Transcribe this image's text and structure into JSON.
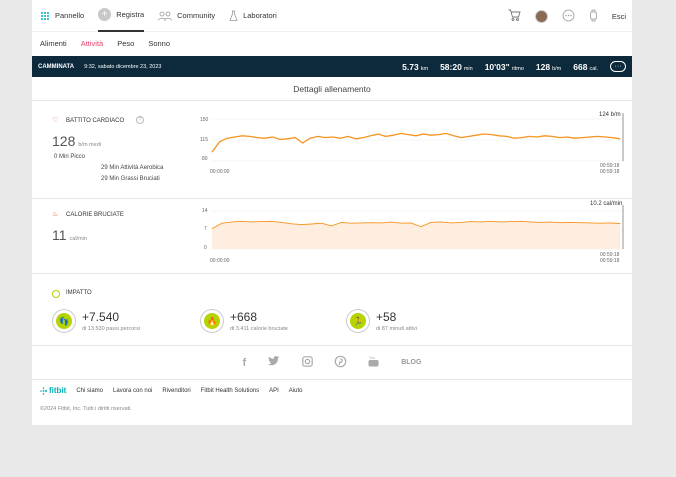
{
  "nav": {
    "items": [
      {
        "label": "Pannello",
        "icon": "dashboard-icon"
      },
      {
        "label": "Registra",
        "icon": "plus-icon"
      },
      {
        "label": "Community",
        "icon": "community-icon"
      },
      {
        "label": "Laboratori",
        "icon": "labs-icon"
      }
    ],
    "logout": "Esci"
  },
  "subnav": [
    "Alimenti",
    "Attività",
    "Peso",
    "Sonno"
  ],
  "activity": {
    "label": "CAMMINATA",
    "date": "9:32, sabato dicembre 23, 2023",
    "stats": [
      {
        "value": "5.73",
        "unit": "km"
      },
      {
        "value": "58:20",
        "unit": "min"
      },
      {
        "value": "10'03\"",
        "unit": "ritmo"
      },
      {
        "value": "128",
        "unit": "b/m"
      },
      {
        "value": "668",
        "unit": "cal."
      }
    ]
  },
  "details_title": "Dettagli allenamento",
  "heart": {
    "title": "BATTITO CARDIACO",
    "value": "128",
    "unit": "b/m medi",
    "peak": "0 Min Picco",
    "aerobic": "29 Min Attività Aerobica",
    "fatburn": "29 Min Grassi Bruciati",
    "max_label": "124 b/m",
    "time_start": "00:00:00",
    "time_end": "00:59:18",
    "time_end2": "00:59:18"
  },
  "calories": {
    "title": "CALORIE BRUCIATE",
    "value": "11",
    "unit": "cal/min",
    "max_label": "10.2 cal/min",
    "time_start": "00:00:00",
    "time_end": "00:59:18",
    "time_end2": "00:59:18"
  },
  "chart_data": [
    {
      "type": "line",
      "title": "BATTITO CARDIACO",
      "yticks": [
        "150",
        "115",
        "80"
      ],
      "ylim": [
        80,
        150
      ],
      "x": [
        "00:00:00",
        "00:59:18"
      ],
      "series": [
        {
          "name": "",
          "values": [
            95,
            112,
            118,
            120,
            122,
            121,
            119,
            118,
            120,
            116,
            117,
            119,
            110,
            118,
            121,
            119,
            120,
            118,
            121,
            117,
            119,
            122,
            125,
            121,
            123,
            126,
            124,
            122,
            125,
            123,
            124,
            126,
            122,
            119,
            121,
            123,
            125,
            124,
            122,
            121,
            118,
            119,
            121,
            120,
            122,
            121,
            119,
            120,
            118,
            119,
            120,
            121,
            120,
            119,
            117
          ]
        }
      ]
    },
    {
      "type": "area",
      "title": "CALORIE BRUCIATE",
      "yticks": [
        "14",
        "7",
        "0"
      ],
      "ylim": [
        0,
        14
      ],
      "x": [
        "00:00:00",
        "00:59:18"
      ],
      "series": [
        {
          "name": "",
          "values": [
            7.5,
            9.5,
            10,
            10.2,
            10,
            10.1,
            10.2,
            9.8,
            9.3,
            9.0,
            9.2,
            9.5,
            8.5,
            9.8,
            9.5,
            9.6,
            9.7,
            9.6,
            9.9,
            9.5,
            9.6,
            8.2,
            9.8,
            10.0,
            9.6,
            9.8,
            10.1,
            10.0,
            10.2,
            10.0,
            10.1,
            10.2,
            10.0,
            9.8,
            9.9,
            9.7,
            9.8,
            9.7,
            9.6,
            9.5,
            9.6,
            9.4
          ]
        }
      ]
    }
  ],
  "impact": {
    "title": "IMPATTO",
    "items": [
      {
        "value": "+7.540",
        "sub": "di 13.530 passi percorsi",
        "icon": "footsteps-icon"
      },
      {
        "value": "+668",
        "sub": "di 3.411 calorie bruciate",
        "icon": "flame-icon"
      },
      {
        "value": "+58",
        "sub": "di 87 minuti attivi",
        "icon": "runner-icon"
      }
    ]
  },
  "social": {
    "blog": "BLOG"
  },
  "footer": {
    "brand": "fitbit",
    "links": [
      "Chi siamo",
      "Lavora con noi",
      "Rivenditori",
      "Fitbit Health Solutions",
      "API",
      "Aiuto"
    ],
    "copyright": "©2024 Fitbit, Inc. Tutti i diritti riservati."
  },
  "colors": {
    "accent": "#e5426b",
    "bar": "#0c2a3b",
    "chart": "#f7931e",
    "impact": "#b6d300"
  }
}
